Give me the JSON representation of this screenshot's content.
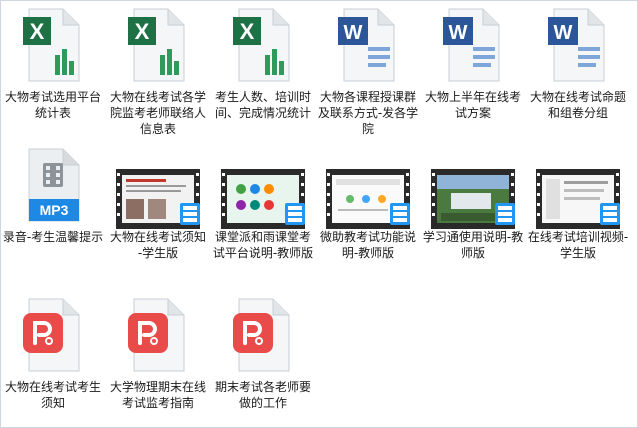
{
  "files": [
    {
      "name": "大物考试选用平台统计表",
      "type": "excel"
    },
    {
      "name": "大物在线考试各学院监考老师联络人信息表",
      "type": "excel"
    },
    {
      "name": "考生人数、培训时间、完成情况统计",
      "type": "excel"
    },
    {
      "name": "大物各课程授课群及联系方式-发各学院",
      "type": "word"
    },
    {
      "name": "大物上半年在线考试方案",
      "type": "word"
    },
    {
      "name": "大物在线考试命题和组卷分组",
      "type": "word"
    },
    {
      "name": "录音-考生温馨提示",
      "type": "mp3",
      "badge": "MP3"
    },
    {
      "name": "大物在线考试须知 -学生版",
      "type": "video"
    },
    {
      "name": "课堂派和雨课堂考试平台说明-教师版",
      "type": "video"
    },
    {
      "name": "微助教考试功能说明-教师版",
      "type": "video"
    },
    {
      "name": "学习通使用说明-教师版",
      "type": "video"
    },
    {
      "name": "在线考试培训视频-学生版",
      "type": "video"
    },
    {
      "name": "大物在线考试考生须知",
      "type": "pdf"
    },
    {
      "name": "大学物理期末在线考试监考指南",
      "type": "pdf"
    },
    {
      "name": "期末考试各老师要做的工作",
      "type": "pdf"
    }
  ],
  "colors": {
    "excel": "#1e7145",
    "word": "#2b579a",
    "pdf": "#e94b4b",
    "mp3": "#1e88e5",
    "video": "#2196f3"
  }
}
